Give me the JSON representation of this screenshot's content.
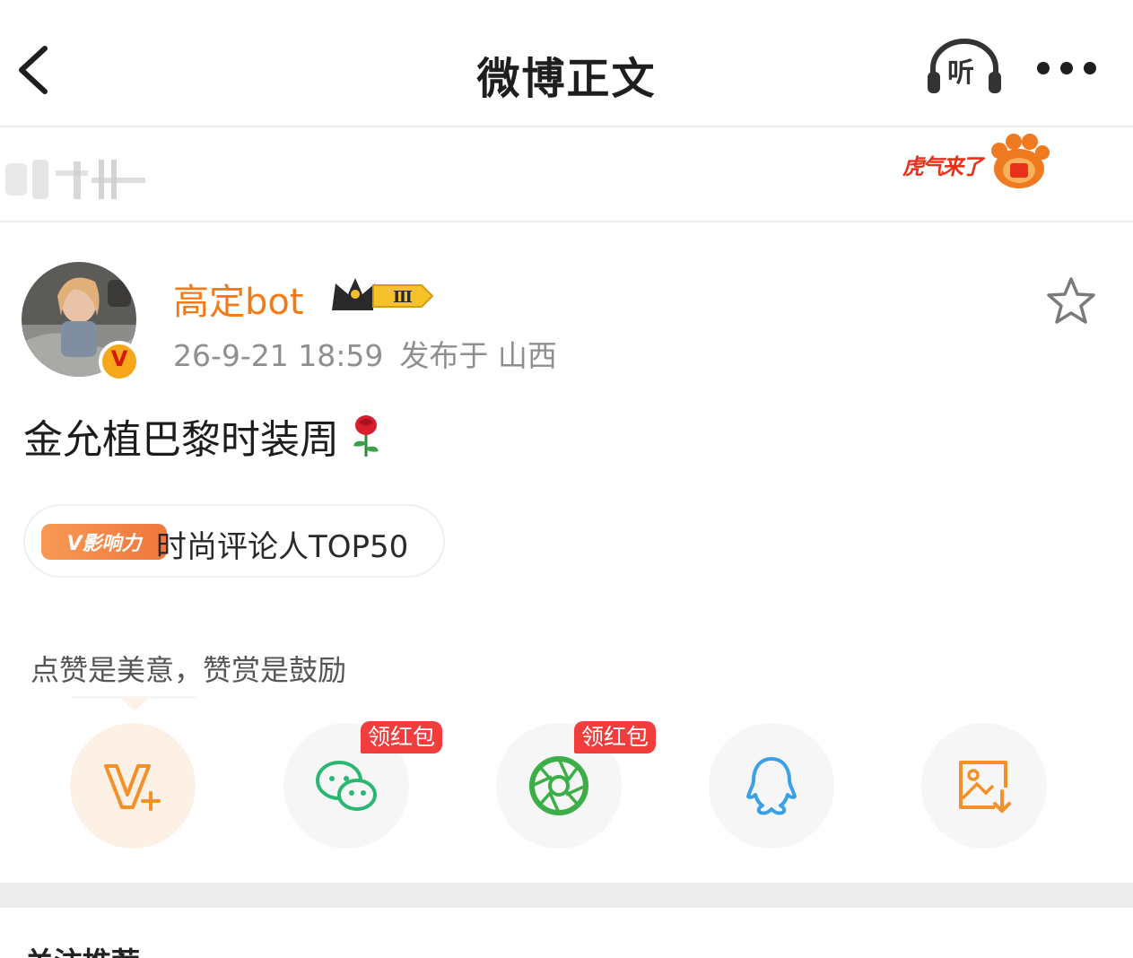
{
  "header": {
    "title": "微博正文",
    "listen_label": "听"
  },
  "banner": {
    "tiger_text": "虎气来了"
  },
  "post": {
    "author": "高定bot",
    "verified_mark": "V",
    "level_badge": "Ⅲ",
    "timestamp": "26-9-21 18:59",
    "location": "发布于 山西",
    "content": "金允植巴黎时装周",
    "topic_badge": "V影响力",
    "topic_label": "时尚评论人TOP50"
  },
  "reward": {
    "tip": "点赞是美意，赞赏是鼓励"
  },
  "share": {
    "items": [
      {
        "name": "V+",
        "icon": "vplus-icon"
      },
      {
        "name": "WeChat",
        "icon": "wechat-icon",
        "tag": "领红包"
      },
      {
        "name": "Moments",
        "icon": "moments-icon",
        "tag": "领红包"
      },
      {
        "name": "QQ",
        "icon": "qq-icon"
      },
      {
        "name": "Save image",
        "icon": "save-image-icon"
      }
    ]
  },
  "following": {
    "title": "关注推荐"
  },
  "colors": {
    "accent_orange": "#f47a15",
    "wechat_green": "#2bb673",
    "qq_blue": "#3aa0e8",
    "red_tag": "#f23d3d"
  }
}
